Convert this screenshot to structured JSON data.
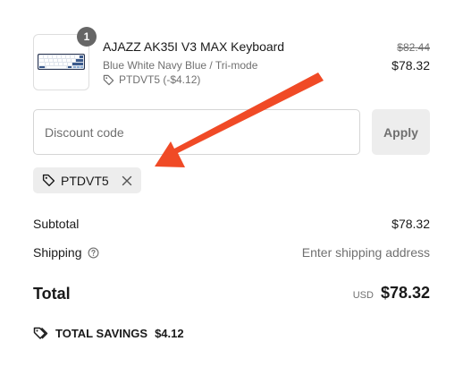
{
  "line_item": {
    "quantity": "1",
    "name": "AJAZZ AK35I V3 MAX Keyboard",
    "variant": "Blue White Navy Blue / Tri-mode",
    "discount": "PTDVT5 (-$4.12)",
    "original_price": "$82.44",
    "price": "$78.32",
    "image_icon": "keyboard-icon"
  },
  "discount_form": {
    "placeholder": "Discount code",
    "apply_label": "Apply"
  },
  "applied_code": {
    "code": "PTDVT5",
    "tag_icon": "tag-icon",
    "remove_icon": "close-icon"
  },
  "summary": {
    "subtotal_label": "Subtotal",
    "subtotal_value": "$78.32",
    "shipping_label": "Shipping",
    "shipping_value": "Enter shipping address",
    "total_label": "Total",
    "currency": "USD",
    "total_value": "$78.32",
    "savings_label": "TOTAL SAVINGS",
    "savings_value": "$4.12"
  },
  "annotation": {
    "arrow_color": "#f04a26"
  },
  "colors": {
    "text": "#1a1a1a",
    "muted": "#707070",
    "chip_bg": "#ededed",
    "badge_bg": "#666666"
  }
}
